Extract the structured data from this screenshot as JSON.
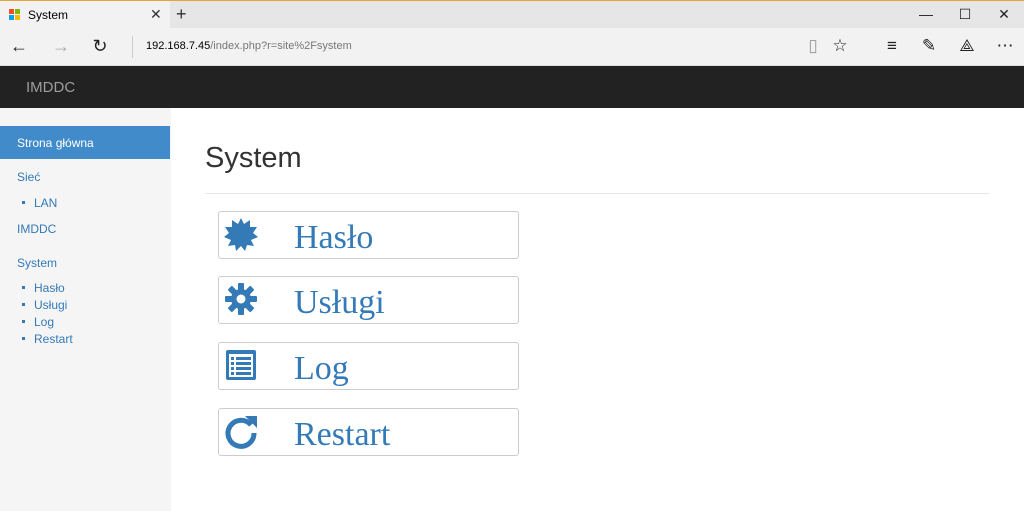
{
  "browser": {
    "tab_title": "System",
    "tab_close": "✕",
    "new_tab": "+",
    "address_host": "192.168.7.45",
    "address_path": "/index.php?r=site%2Fsystem",
    "minimize": "—",
    "maximize": "☐",
    "close": "✕"
  },
  "header": {
    "brand": "IMDDC"
  },
  "sidebar": {
    "home": "Strona główna",
    "network": "Sieć",
    "lan": "LAN",
    "imddc": "IMDDC",
    "system": "System",
    "haslo": "Hasło",
    "uslugi": "Usługi",
    "log": "Log",
    "restart": "Restart"
  },
  "main": {
    "title": "System",
    "buttons": {
      "haslo": "Hasło",
      "uslugi": "Usługi",
      "log": "Log",
      "restart": "Restart"
    }
  },
  "colors": {
    "accent": "#337ab7",
    "active": "#428bca",
    "header_bg": "#222222"
  }
}
